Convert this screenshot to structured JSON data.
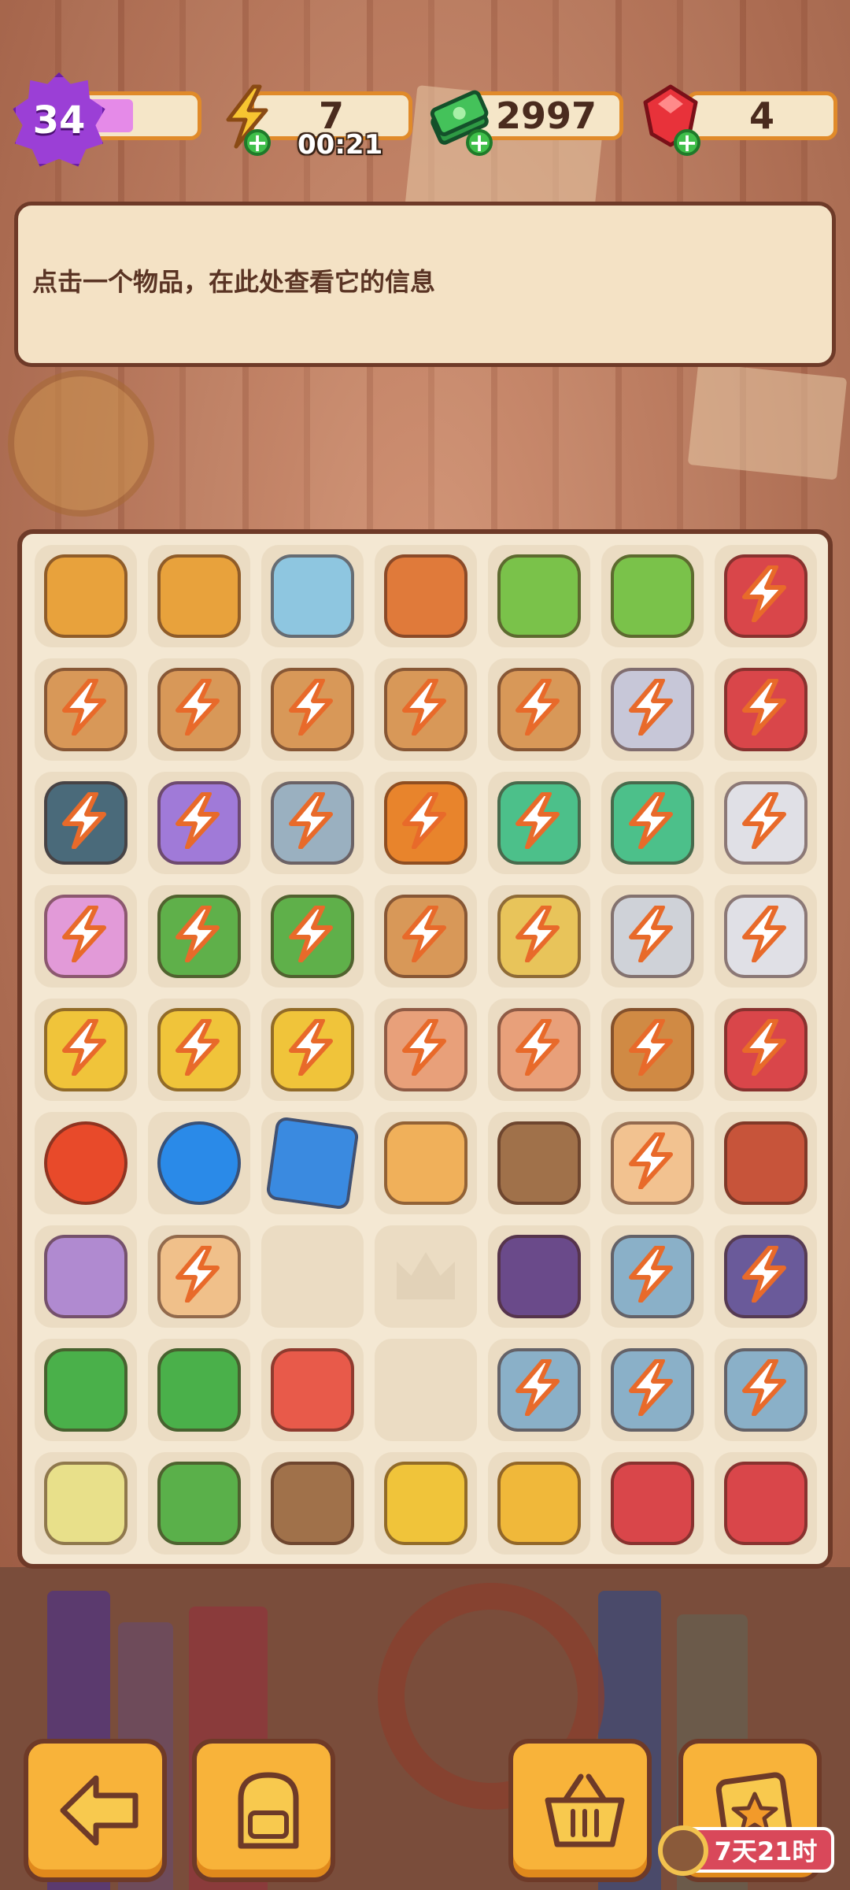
{
  "status": {
    "level": "34",
    "xp_fraction": 0.45,
    "energy": "7",
    "energy_timer": "00:21",
    "cash": "2997",
    "gems": "4"
  },
  "info_panel": {
    "message": "点击一个物品，在此处查看它的信息"
  },
  "board": {
    "rows": [
      [
        {
          "name": "dragon-vase-icon",
          "color": "#e8a23c",
          "locked": false
        },
        {
          "name": "dragon-vase-icon",
          "color": "#e8a23c",
          "locked": false
        },
        {
          "name": "blue-gold-vase-icon",
          "color": "#8ec6e0",
          "locked": false
        },
        {
          "name": "orange-vase-icon",
          "color": "#e07a3a",
          "locked": false
        },
        {
          "name": "flower-bouquet-icon",
          "color": "#7ac24a",
          "locked": false
        },
        {
          "name": "flower-bouquet-icon",
          "color": "#7ac24a",
          "locked": false
        },
        {
          "name": "red-machine-icon",
          "color": "#d9464a",
          "locked": true
        }
      ],
      [
        {
          "name": "wooden-cart-icon",
          "color": "#d89858",
          "locked": true
        },
        {
          "name": "wooden-cart-icon",
          "color": "#d89858",
          "locked": true
        },
        {
          "name": "wood-planks-icon",
          "color": "#d89858",
          "locked": true
        },
        {
          "name": "wood-planks-icon",
          "color": "#d89858",
          "locked": true
        },
        {
          "name": "cardboard-box-icon",
          "color": "#d89858",
          "locked": true
        },
        {
          "name": "old-lady-icon",
          "color": "#c7c7d8",
          "locked": true
        },
        {
          "name": "red-machine-icon",
          "color": "#d9464a",
          "locked": true
        }
      ],
      [
        {
          "name": "jeep-icon",
          "color": "#4a6a7a",
          "locked": true
        },
        {
          "name": "purple-car-icon",
          "color": "#a07ad8",
          "locked": true
        },
        {
          "name": "boat-icon",
          "color": "#9ab0c0",
          "locked": true
        },
        {
          "name": "orange-motorbike-icon",
          "color": "#e8842c",
          "locked": true
        },
        {
          "name": "first-aid-kit-icon",
          "color": "#4cc08a",
          "locked": true
        },
        {
          "name": "first-aid-kit-icon",
          "color": "#4cc08a",
          "locked": true
        },
        {
          "name": "white-robot-icon",
          "color": "#e0e0e6",
          "locked": true
        }
      ],
      [
        {
          "name": "blossom-tree-icon",
          "color": "#e29ad8",
          "locked": true
        },
        {
          "name": "bonsai-tree-icon",
          "color": "#5fb04a",
          "locked": true
        },
        {
          "name": "bonsai-tree-icon",
          "color": "#5fb04a",
          "locked": true
        },
        {
          "name": "crate-tape-icon",
          "color": "#d89858",
          "locked": true
        },
        {
          "name": "crate-tape-icon",
          "color": "#e8c45a",
          "locked": true
        },
        {
          "name": "crate-search-icon",
          "color": "#cfd2d8",
          "locked": true
        },
        {
          "name": "white-robot-icon",
          "color": "#e0e0e6",
          "locked": true
        }
      ],
      [
        {
          "name": "planter-box-icon",
          "color": "#f0c43a",
          "locked": true
        },
        {
          "name": "planter-box-icon",
          "color": "#f0c43a",
          "locked": true
        },
        {
          "name": "planter-box-icon",
          "color": "#f0c43a",
          "locked": true
        },
        {
          "name": "flower-pot-icon",
          "color": "#e8a07a",
          "locked": true
        },
        {
          "name": "flower-pot-icon",
          "color": "#e8a07a",
          "locked": true
        },
        {
          "name": "dog-icon",
          "color": "#d08a44",
          "locked": true
        },
        {
          "name": "red-robot-icon",
          "color": "#d9464a",
          "locked": true
        }
      ],
      [
        {
          "name": "energy-orb-red-icon",
          "color": "#e84a2a",
          "locked": false,
          "shape": "round"
        },
        {
          "name": "energy-orb-blue-icon",
          "color": "#2a8ae8",
          "locked": false,
          "shape": "round"
        },
        {
          "name": "hourglass-gem-icon",
          "color": "#3a8ae0",
          "locked": false,
          "shape": "square"
        },
        {
          "name": "toast-cubes-icon",
          "color": "#f0b05a",
          "locked": false
        },
        {
          "name": "coffee-bag-icon",
          "color": "#a0714a",
          "locked": false
        },
        {
          "name": "lucky-cat-icon",
          "color": "#f2c290",
          "locked": true
        },
        {
          "name": "retro-tv-icon",
          "color": "#c7543a",
          "locked": false
        }
      ],
      [
        {
          "name": "street-lamp-icon",
          "color": "#b08ad0",
          "locked": false
        },
        {
          "name": "cat-bed-icon",
          "color": "#f0c08a",
          "locked": true
        },
        {
          "name": "empty-slot",
          "color": "",
          "locked": false,
          "empty": true
        },
        {
          "name": "crown-silhouette-icon",
          "color": "",
          "locked": false,
          "ghost": true
        },
        {
          "name": "spotlight-icon",
          "color": "#6a4a8a",
          "locked": false
        },
        {
          "name": "film-reel-icon",
          "color": "#8ab0c8",
          "locked": true
        },
        {
          "name": "camera-icon",
          "color": "#6a5a9a",
          "locked": true
        }
      ],
      [
        {
          "name": "small-bonsai-icon",
          "color": "#4ab04a",
          "locked": false
        },
        {
          "name": "small-bonsai-icon",
          "color": "#4ab04a",
          "locked": false
        },
        {
          "name": "flower-basket-icon",
          "color": "#e85a4a",
          "locked": false
        },
        {
          "name": "empty-slot",
          "color": "",
          "locked": false,
          "empty": true
        },
        {
          "name": "film-projector-icon",
          "color": "#8ab0c8",
          "locked": true
        },
        {
          "name": "film-projector-icon",
          "color": "#8ab0c8",
          "locked": true
        },
        {
          "name": "film-camera-icon",
          "color": "#8ab0c8",
          "locked": true
        }
      ],
      [
        {
          "name": "lotion-bottle-icon",
          "color": "#e8e08a",
          "locked": false
        },
        {
          "name": "green-brush-icon",
          "color": "#5ab04a",
          "locked": false
        },
        {
          "name": "paper-scraps-icon",
          "color": "#a0714a",
          "locked": false
        },
        {
          "name": "yellow-bucket-icon",
          "color": "#f0c43a",
          "locked": false
        },
        {
          "name": "yellow-rope-icon",
          "color": "#f0b83a",
          "locked": false
        },
        {
          "name": "red-tray-icon",
          "color": "#d9464a",
          "locked": false
        },
        {
          "name": "red-toolbox-icon",
          "color": "#d9464a",
          "locked": false
        }
      ]
    ]
  },
  "bottom_bar": {
    "event_timer": "7天21时"
  },
  "colors": {
    "accent": "#f8b33a",
    "outline": "#6e3a28",
    "panel": "#f4e2c5"
  }
}
